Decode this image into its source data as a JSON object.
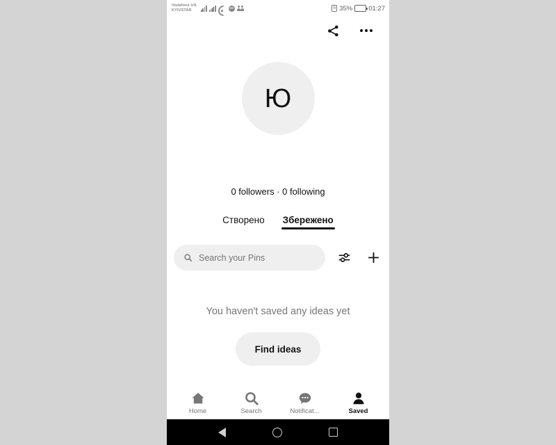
{
  "statusbar": {
    "carrier": "Vodafone UA\nKYIVSTAR",
    "nfc_label": "N",
    "battery_percent": "35%",
    "time": "01:27",
    "icons": [
      "signal-bars-icon",
      "signal-bars-icon",
      "wifi-icon",
      "sync-icon",
      "people-icon"
    ]
  },
  "topbar": {
    "share_icon": "share-icon",
    "overflow_icon": "more-options-icon"
  },
  "profile": {
    "avatar_initial": "Ю",
    "stats": "0 followers · 0 following"
  },
  "tabs": [
    {
      "label": "Створено",
      "active": false
    },
    {
      "label": "Збережено",
      "active": true
    }
  ],
  "search": {
    "placeholder": "Search your Pins",
    "value": "",
    "filter_icon": "sliders-filter-icon",
    "add_icon": "plus-icon"
  },
  "empty_state": {
    "message": "You haven't saved any ideas yet",
    "cta_label": "Find ideas"
  },
  "bottom_nav": [
    {
      "label": "Home",
      "icon": "home-icon",
      "active": false
    },
    {
      "label": "Search",
      "icon": "search-icon",
      "active": false
    },
    {
      "label": "Notificat...",
      "icon": "chat-bubble-icon",
      "active": false
    },
    {
      "label": "Saved",
      "icon": "person-icon",
      "active": true
    }
  ],
  "system_nav": {
    "back": "back-triangle-icon",
    "home": "home-circle-icon",
    "recents": "recents-square-icon"
  },
  "colors": {
    "accent": "#111111",
    "muted": "#767676",
    "surface": "#efefef",
    "page_background": "#d4d4d4",
    "system_nav": "#000000"
  }
}
